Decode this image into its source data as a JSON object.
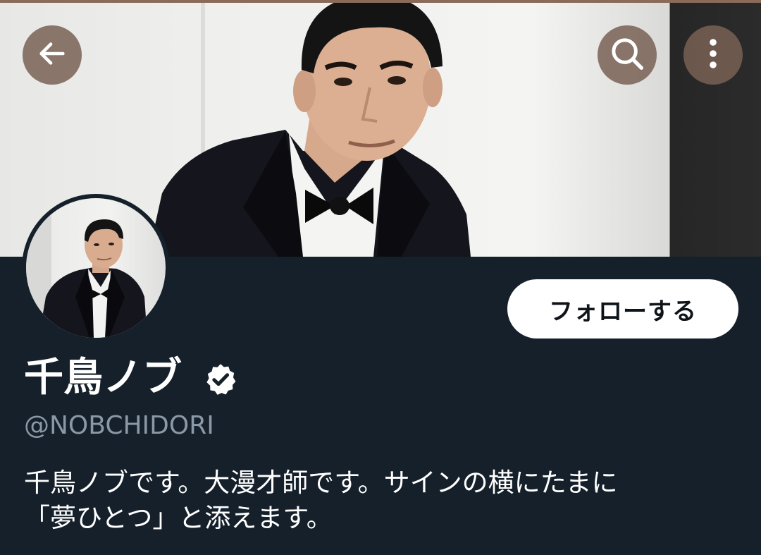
{
  "header": {
    "back_icon": "arrow-left-icon",
    "search_icon": "search-icon",
    "more_icon": "more-vertical-icon",
    "banner_image": "profile-banner-photo"
  },
  "profile": {
    "avatar_image": "profile-avatar-photo",
    "display_name": "千鳥ノブ",
    "verified": true,
    "verified_icon": "verified-badge-icon",
    "handle": "@NOBCHIDORI",
    "follow_label": "フォローする",
    "bio_lines": [
      "千鳥ノブです。大漫才師です。サインの横にたまに",
      "「夢ひとつ」と添えます。"
    ]
  },
  "colors": {
    "background": "#15202b",
    "follow_button_bg": "#ffffff",
    "follow_button_text": "#0f1419",
    "handle_text": "#8b98a5",
    "header_button_bg": "#786054"
  }
}
